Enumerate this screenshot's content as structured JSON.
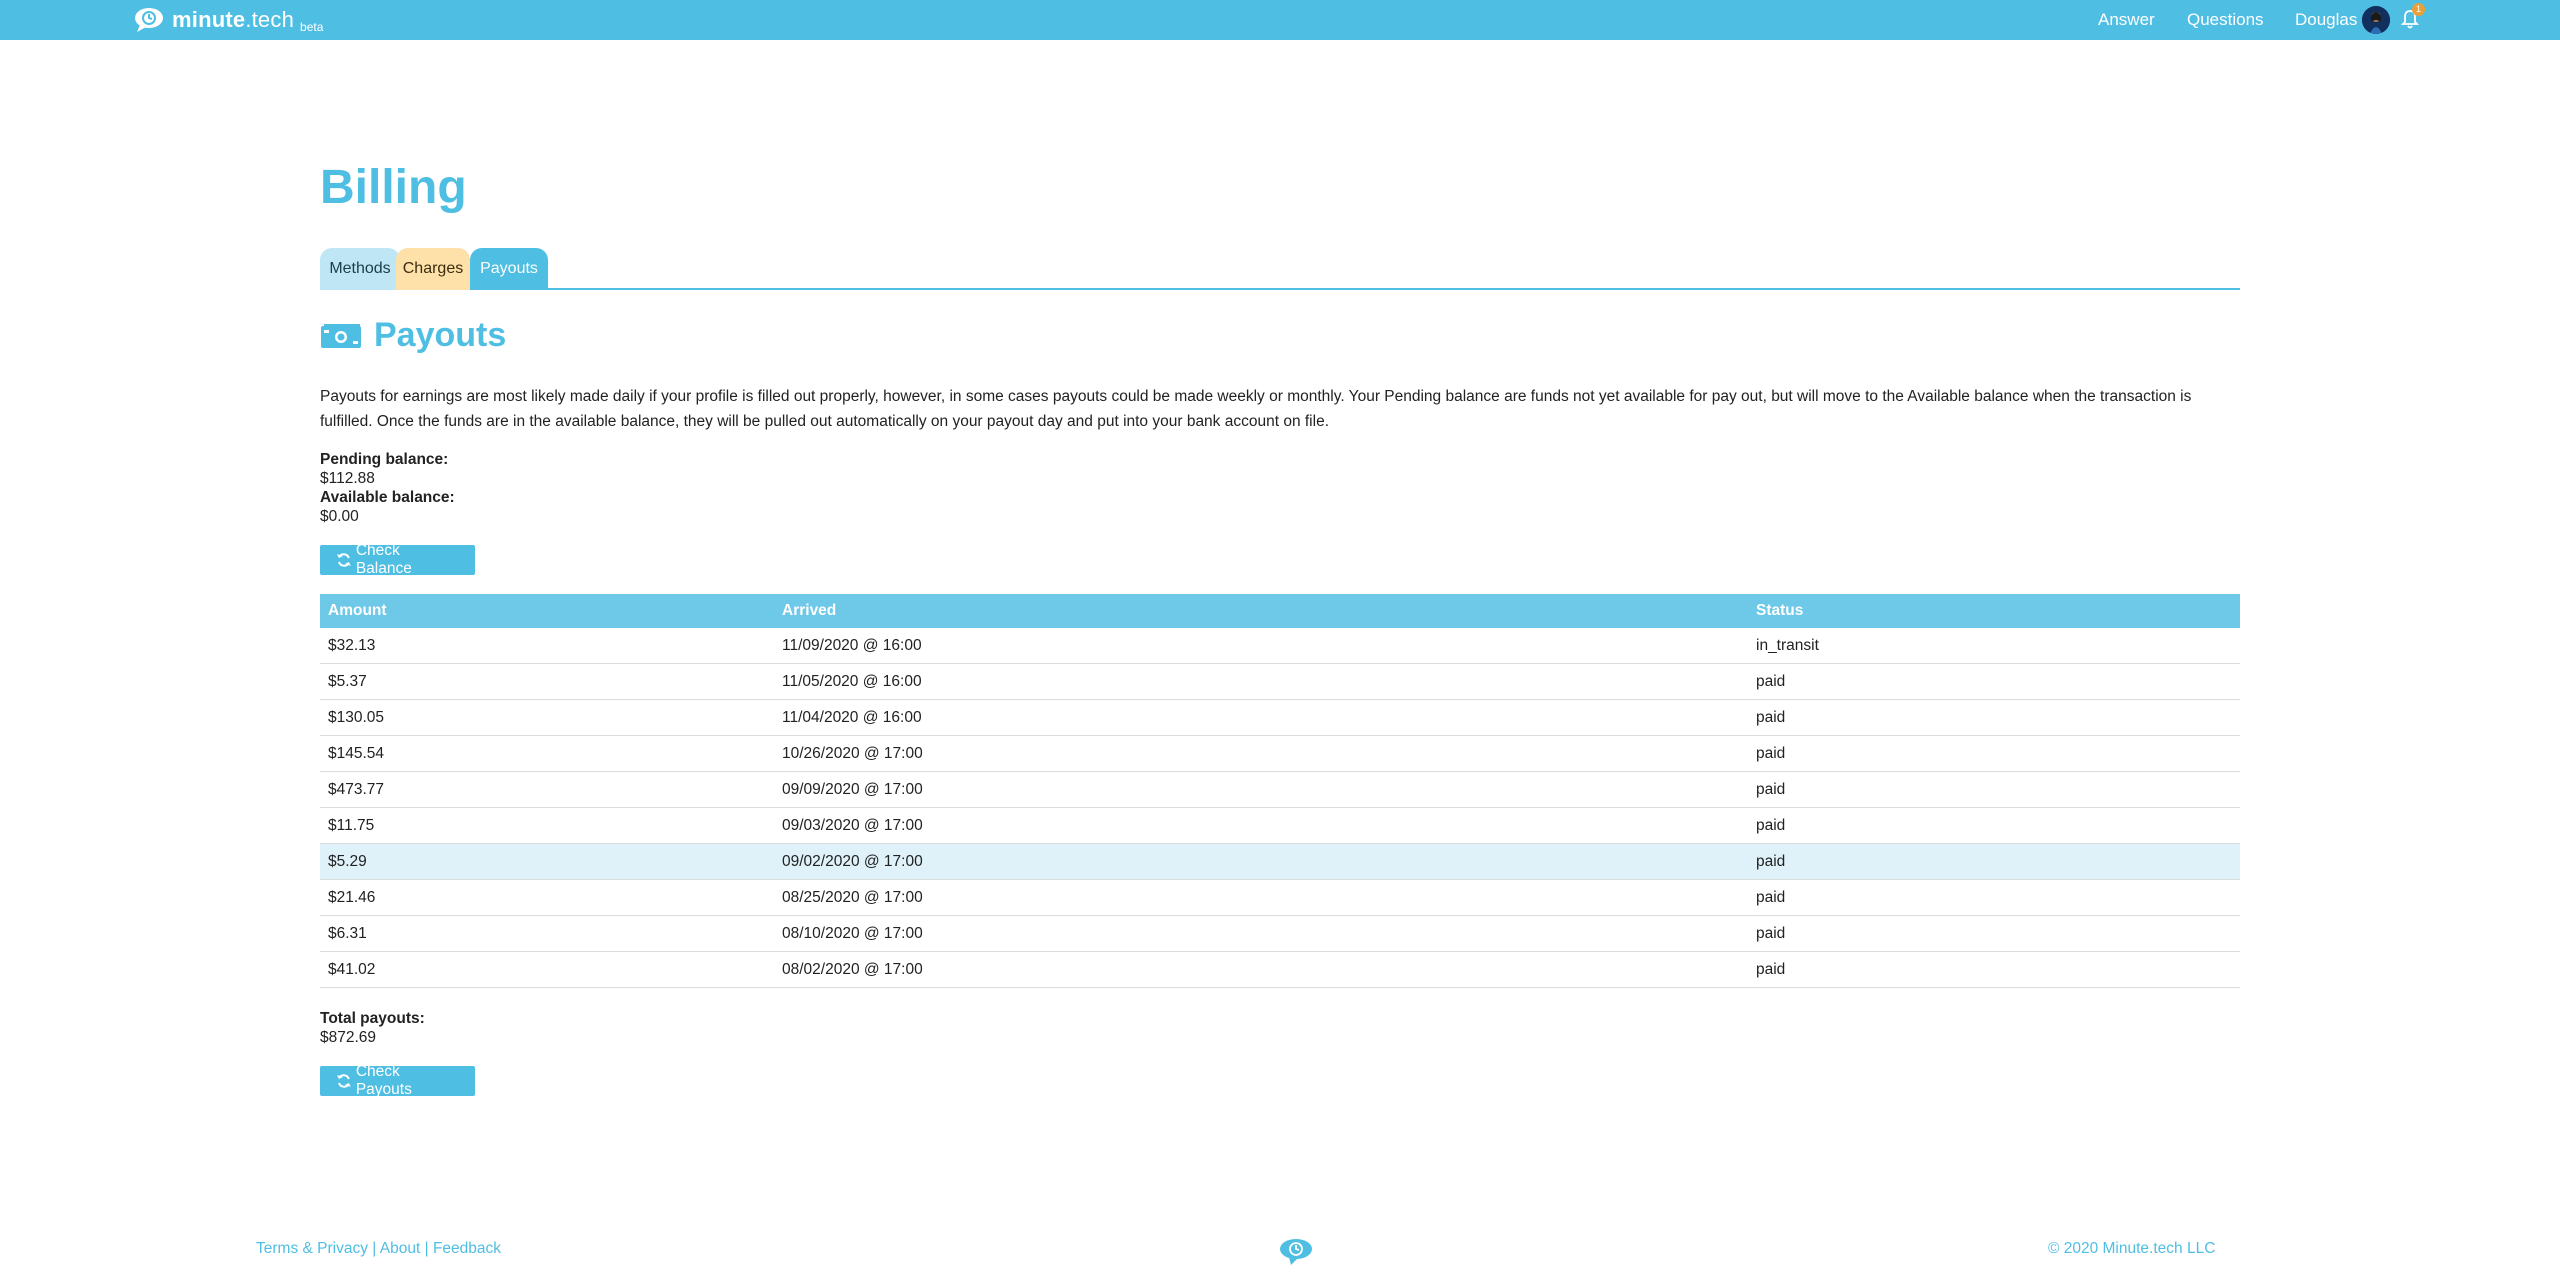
{
  "header": {
    "logo_text": "minute",
    "logo_suffix": ".tech",
    "logo_badge": "beta",
    "nav": {
      "answer": "Answer",
      "questions": "Questions",
      "user": "Douglas"
    },
    "notification_count": "1"
  },
  "page": {
    "title": "Billing",
    "tabs": [
      {
        "label": "Methods"
      },
      {
        "label": "Charges"
      },
      {
        "label": "Payouts"
      }
    ],
    "active_tab": "Payouts"
  },
  "payouts": {
    "section_title": "Payouts",
    "description": "Payouts for earnings are most likely made daily if your profile is filled out properly, however, in some cases payouts could be made weekly or monthly. Your Pending balance are funds not yet available for pay out, but will move to the Available balance when the transaction is fulfilled. Once the funds are in the available balance, they will be pulled out automatically on your payout day and put into your bank account on file.",
    "pending_label": "Pending balance:",
    "pending_value": "$112.88",
    "available_label": "Available balance:",
    "available_value": "$0.00",
    "check_balance_label": "Check Balance",
    "table": {
      "headers": {
        "amount": "Amount",
        "arrived": "Arrived",
        "status": "Status"
      },
      "rows": [
        {
          "amount": "$32.13",
          "arrived": "11/09/2020 @ 16:00",
          "status": "in_transit"
        },
        {
          "amount": "$5.37",
          "arrived": "11/05/2020 @ 16:00",
          "status": "paid"
        },
        {
          "amount": "$130.05",
          "arrived": "11/04/2020 @ 16:00",
          "status": "paid"
        },
        {
          "amount": "$145.54",
          "arrived": "10/26/2020 @ 17:00",
          "status": "paid"
        },
        {
          "amount": "$473.77",
          "arrived": "09/09/2020 @ 17:00",
          "status": "paid"
        },
        {
          "amount": "$11.75",
          "arrived": "09/03/2020 @ 17:00",
          "status": "paid"
        },
        {
          "amount": "$5.29",
          "arrived": "09/02/2020 @ 17:00",
          "status": "paid"
        },
        {
          "amount": "$21.46",
          "arrived": "08/25/2020 @ 17:00",
          "status": "paid"
        },
        {
          "amount": "$6.31",
          "arrived": "08/10/2020 @ 17:00",
          "status": "paid"
        },
        {
          "amount": "$41.02",
          "arrived": "08/02/2020 @ 17:00",
          "status": "paid"
        }
      ]
    },
    "total_label": "Total payouts:",
    "total_value": "$872.69",
    "check_payouts_label": "Check Payouts"
  },
  "footer": {
    "terms": "Terms & Privacy",
    "about": "About",
    "feedback": "Feedback",
    "separator": "|",
    "copyright": "© 2020 Minute.tech LLC"
  },
  "colors": {
    "brand": "#4fbee3",
    "table_header": "#6ec9e8",
    "tab_methods": "#bfe6f4",
    "tab_charges": "#fde1a8",
    "row_highlight": "#dff2f9"
  }
}
